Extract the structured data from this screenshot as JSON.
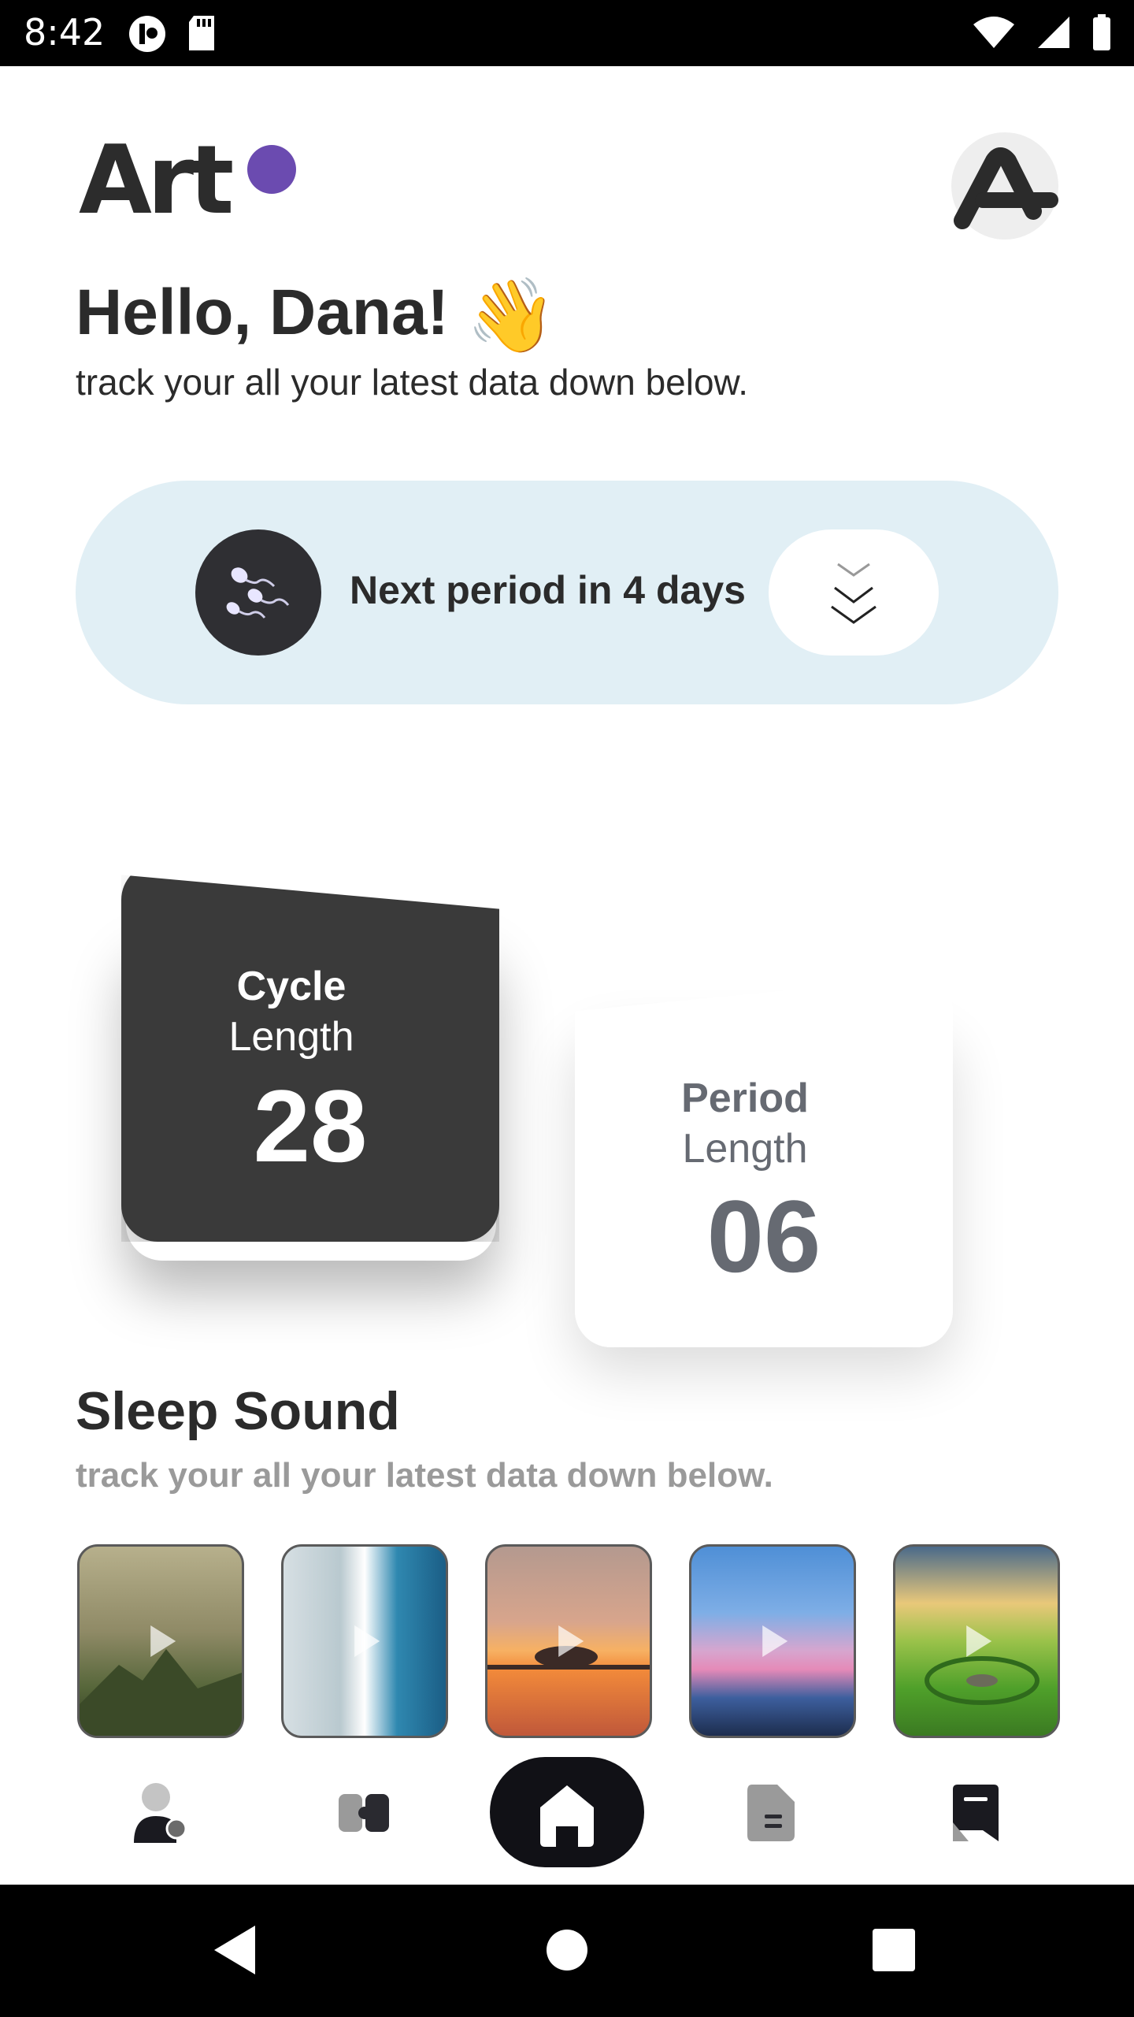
{
  "status_bar": {
    "time": "8:42",
    "left_icons": [
      "app-notification-icon",
      "sd-card-icon"
    ],
    "right_icons": [
      "wifi-icon",
      "signal-icon",
      "battery-icon"
    ]
  },
  "header": {
    "logo_text": "Art",
    "logo_dot_color": "#6b4bb0",
    "avatar_icon": "profile-avatar-icon"
  },
  "greeting": {
    "title": "Hello, Dana!",
    "emoji": "👋",
    "subtitle": "track your all your latest data down below."
  },
  "period_card": {
    "text": "Next period in 4 days",
    "background": "#e1eff5",
    "badge_icon": "sperm-icon",
    "expand_icon": "double-chevron-down-icon"
  },
  "stats": {
    "cycle": {
      "title": "Cycle",
      "subtitle": "Length",
      "value": "28"
    },
    "period": {
      "title": "Period",
      "subtitle": "Length",
      "value": "06"
    }
  },
  "sleep_sound": {
    "title": "Sleep Sound",
    "subtitle": "track your all your latest data down below.",
    "items": [
      {
        "scene": "mountain-cliff",
        "colors": [
          "#a9a37a",
          "#4b5a34"
        ]
      },
      {
        "scene": "ocean-waves",
        "colors": [
          "#2f7aa0",
          "#d8e8ee"
        ]
      },
      {
        "scene": "sunset-lake-tree",
        "colors": [
          "#c98d7a",
          "#f08a3a"
        ]
      },
      {
        "scene": "sunset-beach",
        "colors": [
          "#5e95d8",
          "#e79ac8"
        ]
      },
      {
        "scene": "green-field-stone-circle",
        "colors": [
          "#d8c07a",
          "#4a9a2a"
        ]
      }
    ]
  },
  "bottom_nav": {
    "items": [
      "profile-settings-icon",
      "puzzle-icon",
      "home-icon",
      "document-icon",
      "bookmark-icon"
    ],
    "active": "home-icon"
  },
  "system_nav": [
    "back-icon",
    "home-circle-icon",
    "recents-icon"
  ]
}
